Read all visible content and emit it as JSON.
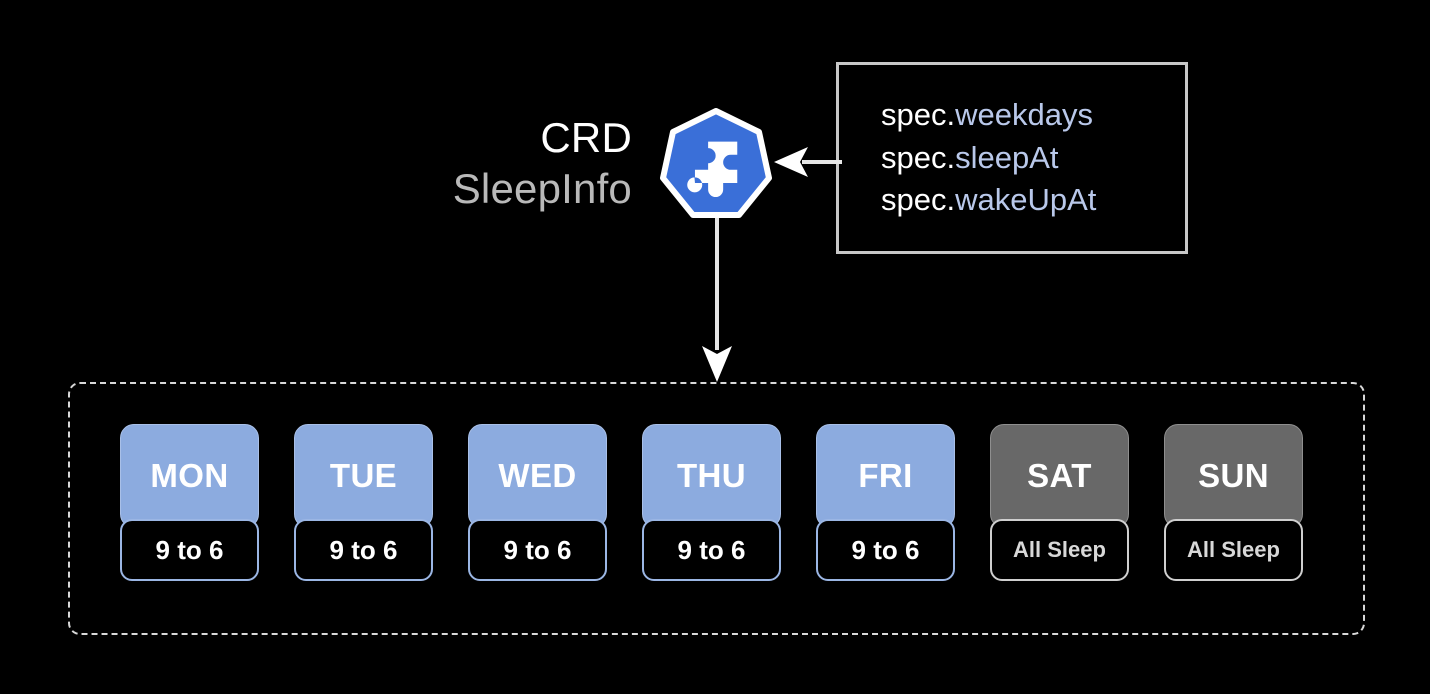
{
  "diagram": {
    "crd": {
      "line1": "CRD",
      "line2": "SleepInfo",
      "icon": "kubernetes-crd-puzzle-icon",
      "icon_color": "#3a6fd8"
    },
    "spec_box": {
      "border_color": "#c7c7c7",
      "prop_color": "#b9c8ea",
      "lines": [
        {
          "prefix": "spec.",
          "prop": "weekdays"
        },
        {
          "prefix": "spec.",
          "prop": "sleepAt"
        },
        {
          "prefix": "spec.",
          "prop": "wakeUpAt"
        }
      ]
    },
    "arrows": {
      "spec_to_crd": "arrow-left",
      "crd_to_week": "arrow-down",
      "color": "#e6e6e6"
    },
    "week": {
      "container_border_color": "#d8d8d8",
      "weekday_color": "#8cabdf",
      "weekend_color": "#686868",
      "days": [
        {
          "name": "MON",
          "schedule": "9 to 6",
          "kind": "weekday"
        },
        {
          "name": "TUE",
          "schedule": "9 to 6",
          "kind": "weekday"
        },
        {
          "name": "WED",
          "schedule": "9 to 6",
          "kind": "weekday"
        },
        {
          "name": "THU",
          "schedule": "9 to 6",
          "kind": "weekday"
        },
        {
          "name": "FRI",
          "schedule": "9 to 6",
          "kind": "weekday"
        },
        {
          "name": "SAT",
          "schedule": "All Sleep",
          "kind": "weekend"
        },
        {
          "name": "SUN",
          "schedule": "All Sleep",
          "kind": "weekend"
        }
      ]
    }
  }
}
